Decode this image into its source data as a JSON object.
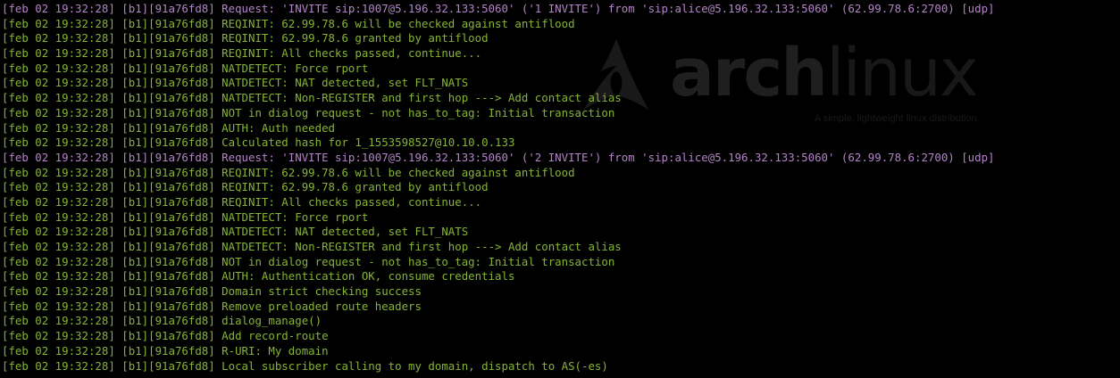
{
  "watermark": {
    "logo_icon": "arch-logo-icon",
    "word_bold": "arch",
    "word_light": "linux",
    "tagline": "A simple, lightweight linux distribution."
  },
  "colors": {
    "background": "#000000",
    "log_info": "#86b434",
    "log_request": "#b484c8"
  },
  "log_lines": [
    {
      "kind": "req",
      "text": "[feb 02 19:32:28] [b1][91a76fd8] Request: 'INVITE sip:1007@5.196.32.133:5060' ('1 INVITE') from 'sip:alice@5.196.32.133:5060' (62.99.78.6:2700) [udp]"
    },
    {
      "kind": "info",
      "text": "[feb 02 19:32:28] [b1][91a76fd8] REQINIT: 62.99.78.6 will be checked against antiflood"
    },
    {
      "kind": "info",
      "text": "[feb 02 19:32:28] [b1][91a76fd8] REQINIT: 62.99.78.6 granted by antiflood"
    },
    {
      "kind": "info",
      "text": "[feb 02 19:32:28] [b1][91a76fd8] REQINIT: All checks passed, continue..."
    },
    {
      "kind": "info",
      "text": "[feb 02 19:32:28] [b1][91a76fd8] NATDETECT: Force rport"
    },
    {
      "kind": "info",
      "text": "[feb 02 19:32:28] [b1][91a76fd8] NATDETECT: NAT detected, set FLT_NATS"
    },
    {
      "kind": "info",
      "text": "[feb 02 19:32:28] [b1][91a76fd8] NATDETECT: Non-REGISTER and first hop ---> Add contact alias"
    },
    {
      "kind": "info",
      "text": "[feb 02 19:32:28] [b1][91a76fd8] NOT in dialog request - not has_to_tag: Initial transaction"
    },
    {
      "kind": "info",
      "text": "[feb 02 19:32:28] [b1][91a76fd8] AUTH: Auth needed"
    },
    {
      "kind": "info",
      "text": "[feb 02 19:32:28] [b1][91a76fd8] Calculated hash for 1_1553598527@10.10.0.133"
    },
    {
      "kind": "req",
      "text": "[feb 02 19:32:28] [b1][91a76fd8] Request: 'INVITE sip:1007@5.196.32.133:5060' ('2 INVITE') from 'sip:alice@5.196.32.133:5060' (62.99.78.6:2700) [udp]"
    },
    {
      "kind": "info",
      "text": "[feb 02 19:32:28] [b1][91a76fd8] REQINIT: 62.99.78.6 will be checked against antiflood"
    },
    {
      "kind": "info",
      "text": "[feb 02 19:32:28] [b1][91a76fd8] REQINIT: 62.99.78.6 granted by antiflood"
    },
    {
      "kind": "info",
      "text": "[feb 02 19:32:28] [b1][91a76fd8] REQINIT: All checks passed, continue..."
    },
    {
      "kind": "info",
      "text": "[feb 02 19:32:28] [b1][91a76fd8] NATDETECT: Force rport"
    },
    {
      "kind": "info",
      "text": "[feb 02 19:32:28] [b1][91a76fd8] NATDETECT: NAT detected, set FLT_NATS"
    },
    {
      "kind": "info",
      "text": "[feb 02 19:32:28] [b1][91a76fd8] NATDETECT: Non-REGISTER and first hop ---> Add contact alias"
    },
    {
      "kind": "info",
      "text": "[feb 02 19:32:28] [b1][91a76fd8] NOT in dialog request - not has_to_tag: Initial transaction"
    },
    {
      "kind": "info",
      "text": "[feb 02 19:32:28] [b1][91a76fd8] AUTH: Authentication OK, consume credentials"
    },
    {
      "kind": "info",
      "text": "[feb 02 19:32:28] [b1][91a76fd8] Domain strict checking success"
    },
    {
      "kind": "info",
      "text": "[feb 02 19:32:28] [b1][91a76fd8] Remove preloaded route headers"
    },
    {
      "kind": "info",
      "text": "[feb 02 19:32:28] [b1][91a76fd8] dialog_manage()"
    },
    {
      "kind": "info",
      "text": "[feb 02 19:32:28] [b1][91a76fd8] Add record-route"
    },
    {
      "kind": "info",
      "text": "[feb 02 19:32:28] [b1][91a76fd8] R-URI: My domain"
    },
    {
      "kind": "info",
      "text": "[feb 02 19:32:28] [b1][91a76fd8] Local subscriber calling to my domain, dispatch to AS(-es)"
    }
  ]
}
